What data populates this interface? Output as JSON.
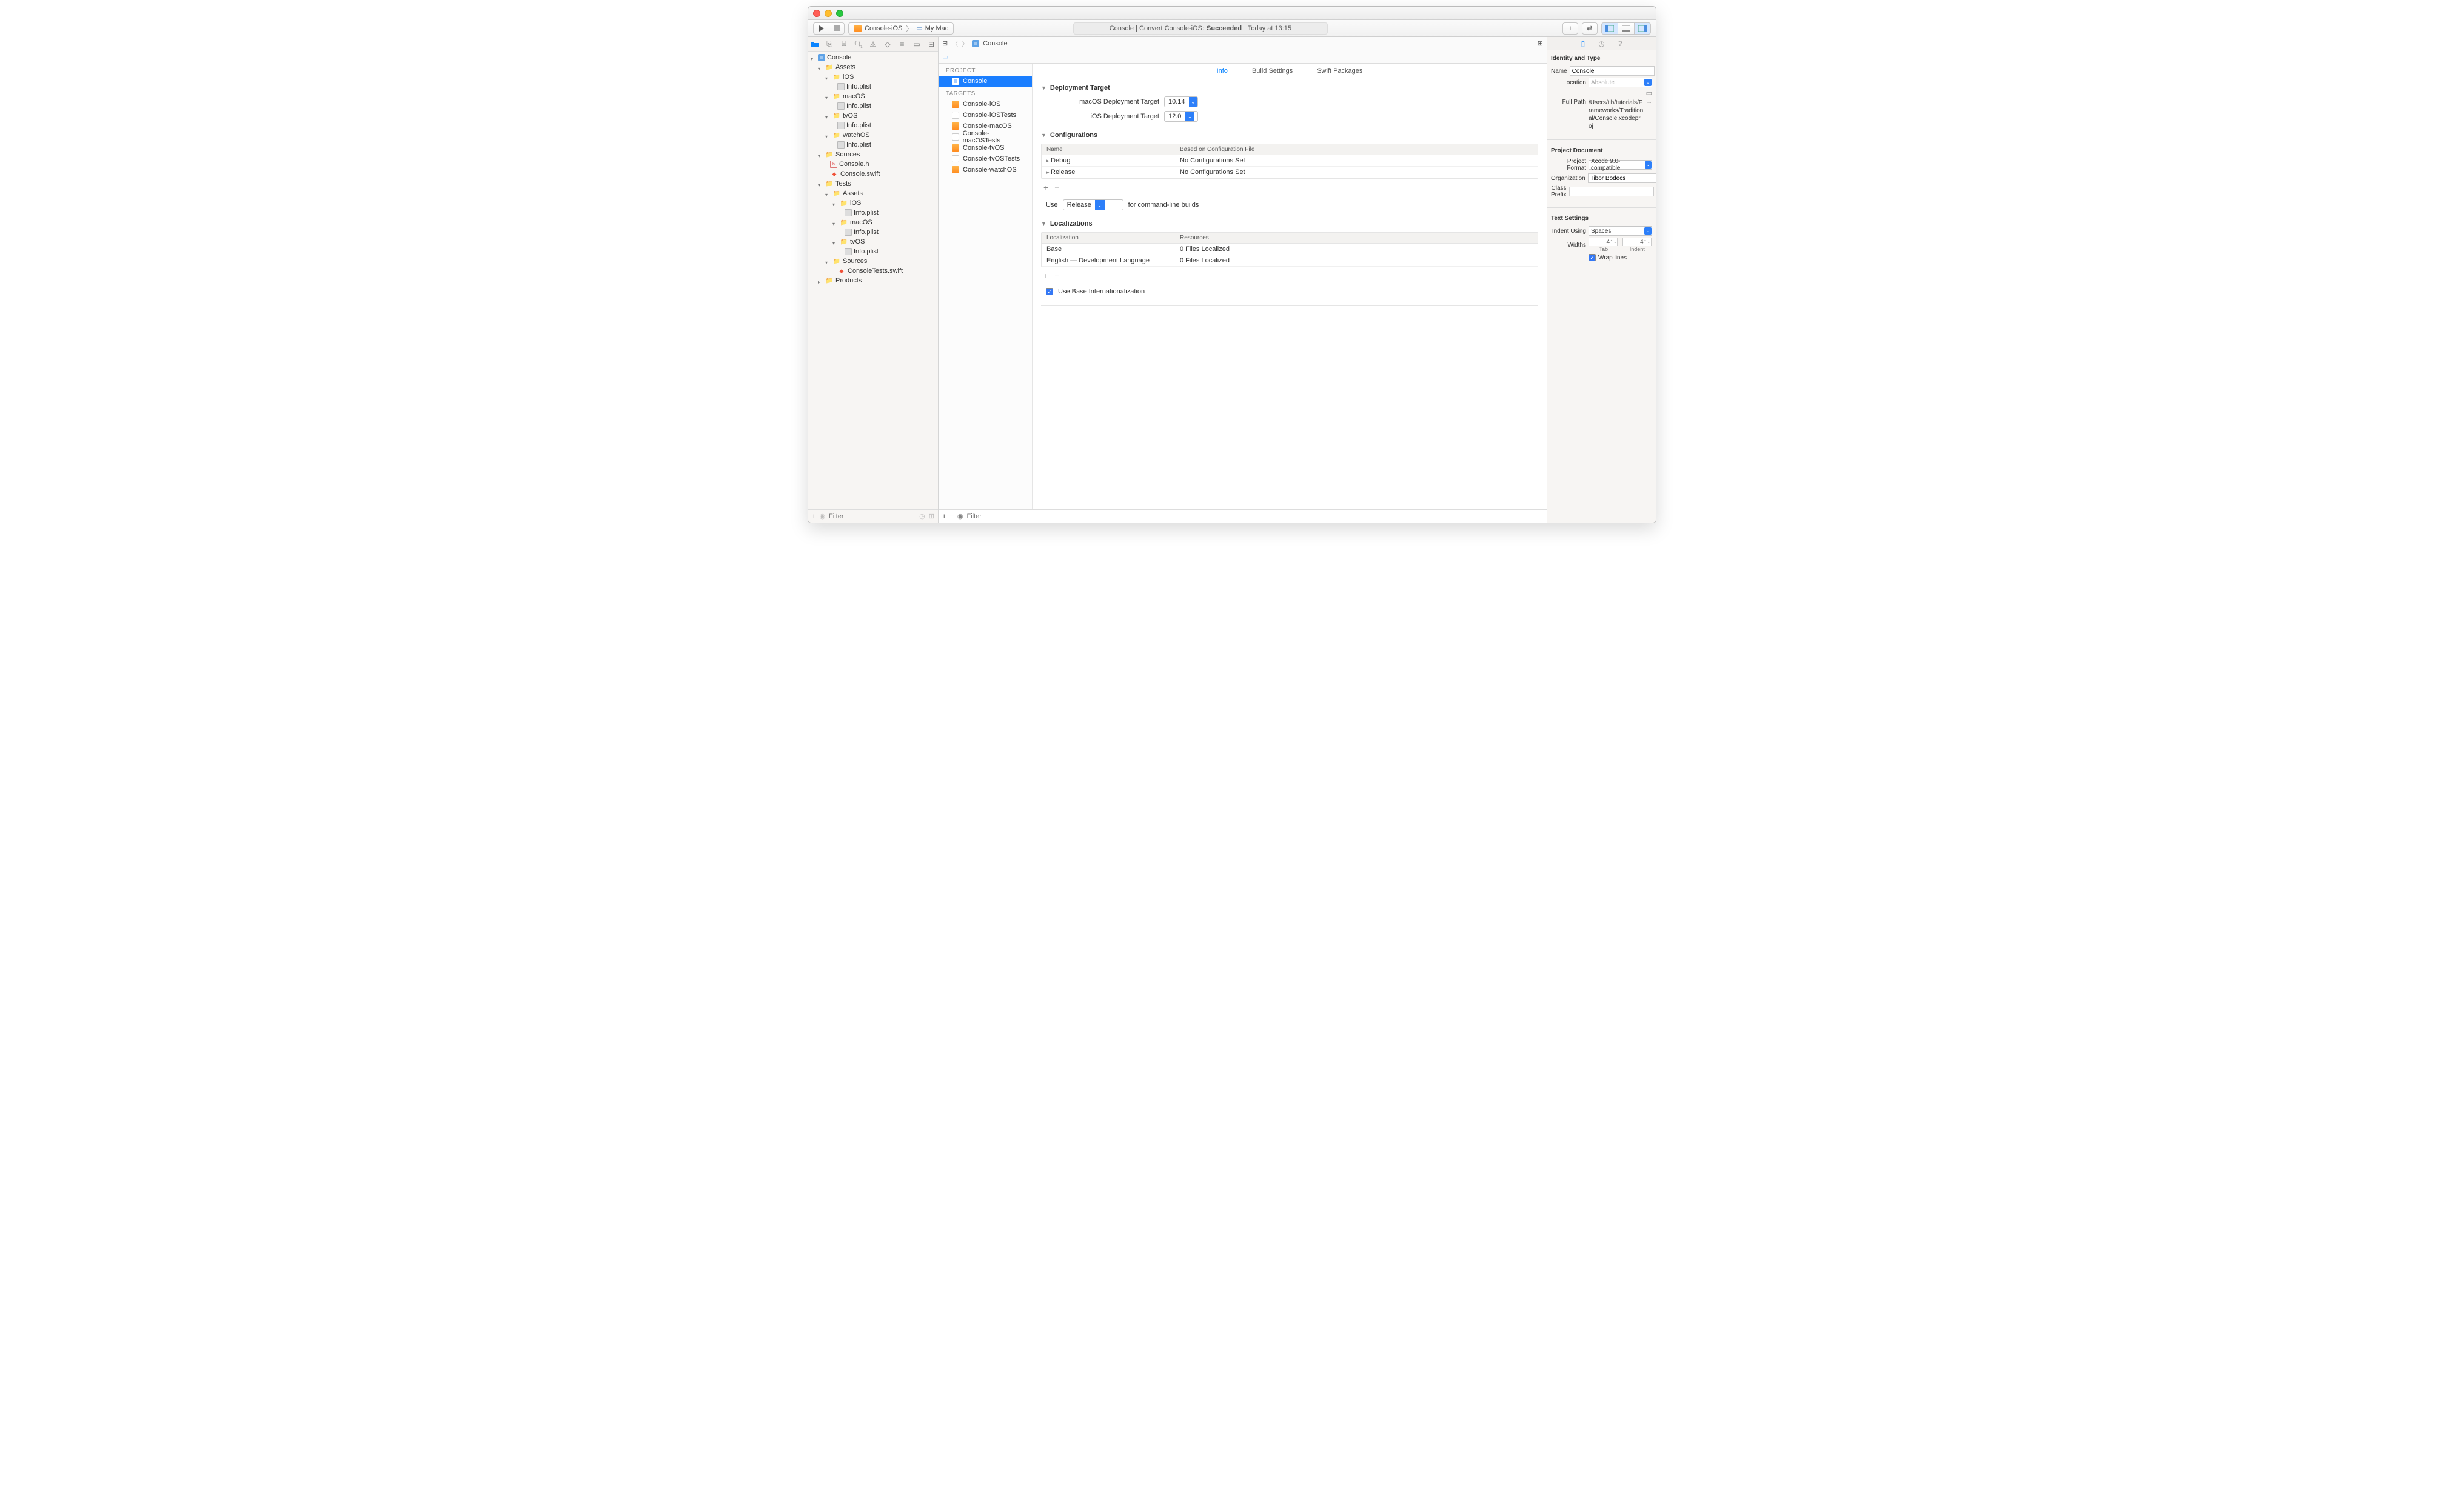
{
  "scheme": {
    "target": "Console-iOS",
    "destination": "My Mac"
  },
  "status": {
    "prefix": "Console | Convert Console-iOS:",
    "result": "Succeeded",
    "suffix": "| Today at 13:15"
  },
  "breadcrumb": {
    "item": "Console"
  },
  "navigator": {
    "root": "Console",
    "assets": "Assets",
    "ios": "iOS",
    "macos": "macOS",
    "tvos": "tvOS",
    "watchos": "watchOS",
    "infoplist": "Info.plist",
    "sources": "Sources",
    "console_h": "Console.h",
    "console_swift": "Console.swift",
    "tests": "Tests",
    "tests_assets": "Assets",
    "t_ios": "iOS",
    "t_macos": "macOS",
    "t_tvos": "tvOS",
    "t_sources": "Sources",
    "consoletests_swift": "ConsoleTests.swift",
    "products": "Products",
    "filter": "Filter"
  },
  "pe": {
    "section_project": "PROJECT",
    "project": "Console",
    "section_targets": "TARGETS",
    "targets": [
      "Console-iOS",
      "Console-iOSTests",
      "Console-macOS",
      "Console-macOSTests",
      "Console-tvOS",
      "Console-tvOSTests",
      "Console-watchOS"
    ],
    "filter": "Filter"
  },
  "tabs": {
    "info": "Info",
    "build_settings": "Build Settings",
    "swift_packages": "Swift Packages"
  },
  "deploy": {
    "title": "Deployment Target",
    "macos_lbl": "macOS Deployment Target",
    "macos_val": "10.14",
    "ios_lbl": "iOS Deployment Target",
    "ios_val": "12.0"
  },
  "configs": {
    "title": "Configurations",
    "col_name": "Name",
    "col_based": "Based on Configuration File",
    "rows": [
      {
        "name": "Debug",
        "based": "No Configurations Set"
      },
      {
        "name": "Release",
        "based": "No Configurations Set"
      }
    ],
    "use": "Use",
    "use_val": "Release",
    "use_suffix": "for command-line builds"
  },
  "loc": {
    "title": "Localizations",
    "col1": "Localization",
    "col2": "Resources",
    "rows": [
      {
        "l": "Base",
        "r": "0 Files Localized"
      },
      {
        "l": "English — Development Language",
        "r": "0 Files Localized"
      }
    ],
    "base_intl": "Use Base Internationalization"
  },
  "inspector": {
    "identity": "Identity and Type",
    "name_lbl": "Name",
    "name_val": "Console",
    "location_lbl": "Location",
    "location_val": "Absolute",
    "fullpath_lbl": "Full Path",
    "fullpath_val": "/Users/tib/tutorials/Frameworks/Traditional/Console.xcodeproj",
    "projdoc": "Project Document",
    "format_lbl": "Project Format",
    "format_val": "Xcode 9.0-compatible",
    "org_lbl": "Organization",
    "org_val": "Tibor Bödecs",
    "prefix_lbl": "Class Prefix",
    "prefix_val": "",
    "text": "Text Settings",
    "indent_lbl": "Indent Using",
    "indent_val": "Spaces",
    "widths_lbl": "Widths",
    "tab_val": "4",
    "indent_w_val": "4",
    "tab": "Tab",
    "indent": "Indent",
    "wrap": "Wrap lines"
  }
}
